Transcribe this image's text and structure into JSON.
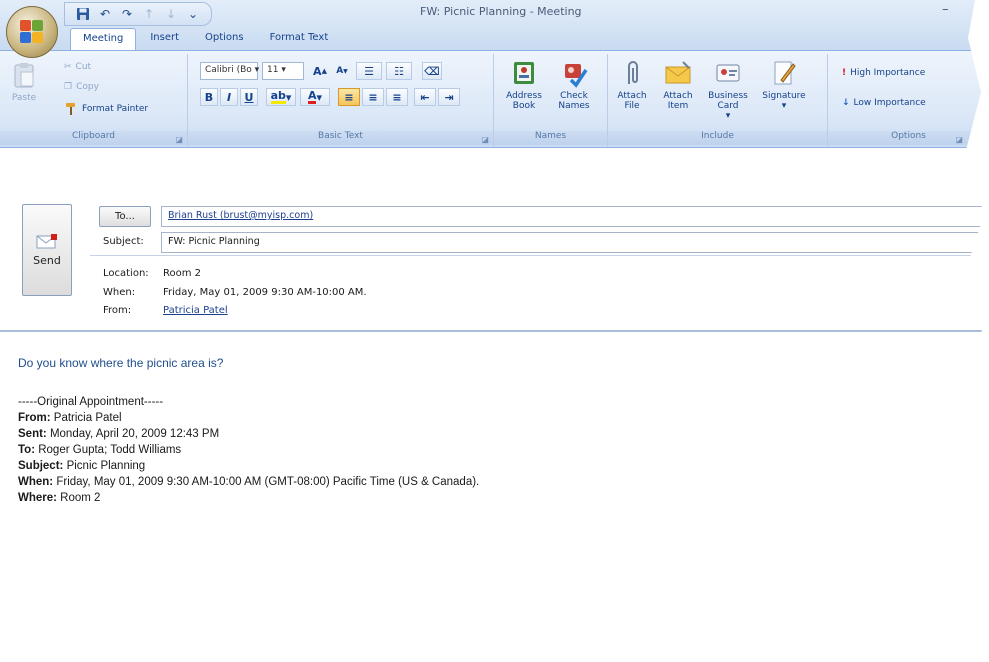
{
  "window": {
    "title": "FW: Picnic Planning - Meeting",
    "minimize_glyph": "–"
  },
  "quick_access": [
    {
      "name": "save-icon",
      "glyph": "💾"
    },
    {
      "name": "undo-icon",
      "glyph": "↶"
    },
    {
      "name": "redo-icon",
      "glyph": "↷"
    },
    {
      "name": "previous-item-icon",
      "glyph": "↑"
    },
    {
      "name": "next-item-icon",
      "glyph": "↓"
    },
    {
      "name": "customize-qat-icon",
      "glyph": "⌄"
    }
  ],
  "tabs": [
    "Meeting",
    "Insert",
    "Options",
    "Format Text"
  ],
  "ribbon": {
    "clipboard": {
      "label": "Clipboard",
      "paste": "Paste",
      "cut": "Cut",
      "copy": "Copy",
      "format_painter": "Format Painter"
    },
    "basic_text": {
      "label": "Basic Text",
      "font": "Calibri (Bo",
      "size": "11",
      "grow_font": "A",
      "shrink_font": "A",
      "bold": "B",
      "italic": "I",
      "underline": "U",
      "font_color": "A"
    },
    "names": {
      "label": "Names",
      "address_book": "Address Book",
      "check_names": "Check Names"
    },
    "include": {
      "label": "Include",
      "attach_file": "Attach File",
      "attach_item": "Attach Item",
      "business_card": "Business Card",
      "signature": "Signature"
    },
    "options": {
      "label": "Options",
      "high_importance": "High Importance",
      "low_importance": "Low Importance"
    }
  },
  "form": {
    "send": "Send",
    "to_button": "To...",
    "to_value": "Brian Rust (brust@myisp.com)",
    "subject_label": "Subject:",
    "subject_value": "FW: Picnic Planning",
    "location_label": "Location:",
    "location_value": "Room 2",
    "when_label": "When:",
    "when_value": "Friday, May 01, 2009 9:30 AM-10:00 AM.",
    "from_label": "From:",
    "from_value": "Patricia Patel"
  },
  "message": {
    "question": "Do you know where the picnic area is?",
    "original_header": "-----Original Appointment-----",
    "from_label": "From:",
    "from_value": " Patricia Patel",
    "sent_label": "Sent:",
    "sent_value": " Monday, April 20, 2009 12:43 PM",
    "to_label": "To:",
    "to_value": " Roger Gupta; Todd Williams",
    "subject_label": "Subject:",
    "subject_value": " Picnic Planning",
    "when_label": "When:",
    "when_value": " Friday, May 01, 2009 9:30 AM-10:00 AM (GMT-08:00) Pacific Time (US & Canada).",
    "where_label": "Where:",
    "where_value": " Room 2"
  },
  "colors": {
    "ribbon_blue": "#dbe7f7",
    "label_blue": "#15428b",
    "body_question": "#1f4e8c"
  }
}
